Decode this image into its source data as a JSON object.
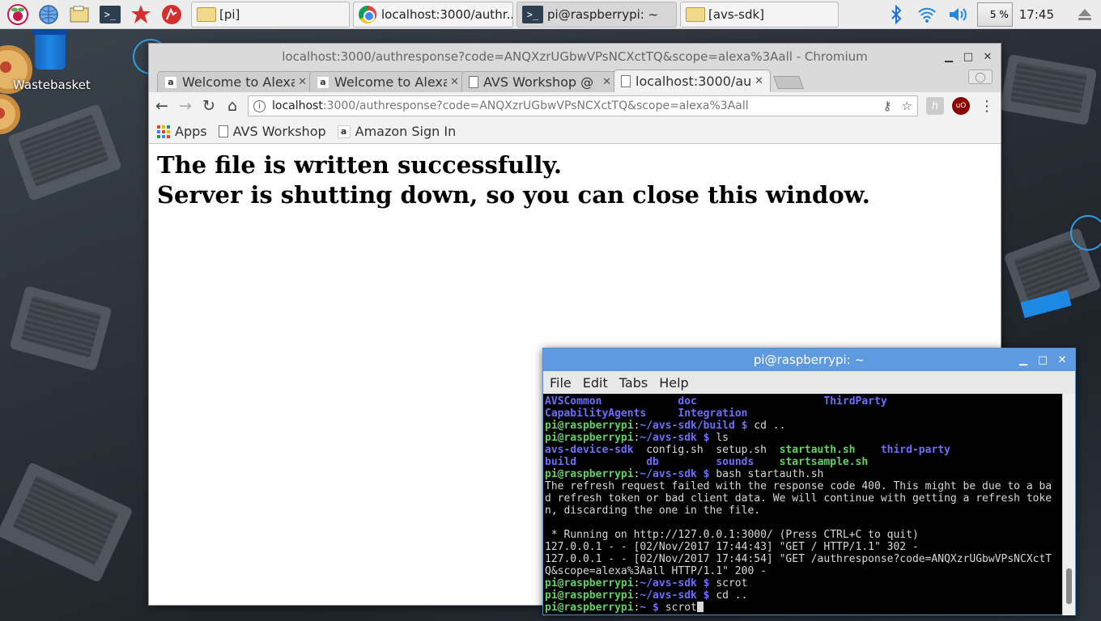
{
  "taskbar": {
    "buttons": [
      {
        "label": "[pi]",
        "icon": "folder-icon"
      },
      {
        "label": "localhost:3000/authr...",
        "icon": "chromium-icon"
      },
      {
        "label": "pi@raspberrypi: ~",
        "icon": "terminal-icon"
      },
      {
        "label": "[avs-sdk]",
        "icon": "folder-icon"
      }
    ],
    "cpu": "5 %",
    "clock": "17:45"
  },
  "desktop": {
    "wastebasket_label": "Wastebasket"
  },
  "chromium": {
    "window_title": "localhost:3000/authresponse?code=ANQXzrUGbwVPsNCXctTQ&scope=alexa%3Aall - Chromium",
    "tabs": [
      {
        "label": "Welcome to Alexa",
        "icon": "amazon-icon"
      },
      {
        "label": "Welcome to Alexa",
        "icon": "amazon-icon"
      },
      {
        "label": "AVS Workshop @",
        "icon": "document-icon"
      },
      {
        "label": "localhost:3000/au",
        "icon": "document-icon"
      }
    ],
    "url_host": "localhost",
    "url_rest": ":3000/authresponse?code=ANQXzrUGbwVPsNCXctTQ&scope=alexa%3Aall",
    "bookmarks": [
      "Apps",
      "AVS Workshop",
      "Amazon Sign In"
    ],
    "content": {
      "line1": "The file is written successfully.",
      "line2": "Server is shutting down, so you can close this window."
    }
  },
  "terminal": {
    "title": "pi@raspberrypi: ~",
    "menu": [
      "File",
      "Edit",
      "Tabs",
      "Help"
    ],
    "lines": [
      {
        "segments": [
          {
            "t": "AVSCommon",
            "c": "dir"
          },
          {
            "t": "            "
          },
          {
            "t": "doc",
            "c": "dir"
          },
          {
            "t": "                    "
          },
          {
            "t": "ThirdParty",
            "c": "dir"
          }
        ]
      },
      {
        "segments": [
          {
            "t": "CapabilityAgents",
            "c": "dir"
          },
          {
            "t": "     "
          },
          {
            "t": "Integration",
            "c": "dir"
          }
        ]
      },
      {
        "segments": [
          {
            "t": "pi@raspberrypi",
            "c": "p"
          },
          {
            "t": ":"
          },
          {
            "t": "~/avs-sdk/build $",
            "c": "path"
          },
          {
            "t": " cd .."
          }
        ]
      },
      {
        "segments": [
          {
            "t": "pi@raspberrypi",
            "c": "p"
          },
          {
            "t": ":"
          },
          {
            "t": "~/avs-sdk $",
            "c": "path"
          },
          {
            "t": " ls"
          }
        ]
      },
      {
        "segments": [
          {
            "t": "avs-device-sdk",
            "c": "dir"
          },
          {
            "t": "  config.sh  setup.sh  "
          },
          {
            "t": "startauth.sh",
            "c": "exe"
          },
          {
            "t": "    "
          },
          {
            "t": "third-party",
            "c": "dir"
          }
        ]
      },
      {
        "segments": [
          {
            "t": "build",
            "c": "dir"
          },
          {
            "t": "           "
          },
          {
            "t": "db",
            "c": "dir"
          },
          {
            "t": "         "
          },
          {
            "t": "sounds",
            "c": "dir"
          },
          {
            "t": "    "
          },
          {
            "t": "startsample.sh",
            "c": "exe"
          }
        ]
      },
      {
        "segments": [
          {
            "t": "pi@raspberrypi",
            "c": "p"
          },
          {
            "t": ":"
          },
          {
            "t": "~/avs-sdk $",
            "c": "path"
          },
          {
            "t": " bash startauth.sh"
          }
        ]
      },
      {
        "segments": [
          {
            "t": "The refresh request failed with the response code 400. This might be due to a ba"
          }
        ]
      },
      {
        "segments": [
          {
            "t": "d refresh token or bad client data. We will continue with getting a refresh toke"
          }
        ]
      },
      {
        "segments": [
          {
            "t": "n, discarding the one in the file."
          }
        ]
      },
      {
        "segments": [
          {
            "t": " "
          }
        ]
      },
      {
        "segments": [
          {
            "t": " * Running on http://127.0.0.1:3000/ (Press CTRL+C to quit)"
          }
        ]
      },
      {
        "segments": [
          {
            "t": "127.0.0.1 - - [02/Nov/2017 17:44:43] \"GET / HTTP/1.1\" 302 -"
          }
        ]
      },
      {
        "segments": [
          {
            "t": "127.0.0.1 - - [02/Nov/2017 17:44:54] \"GET /authresponse?code=ANQXzrUGbwVPsNCXctT"
          }
        ]
      },
      {
        "segments": [
          {
            "t": "Q&scope=alexa%3Aall HTTP/1.1\" 200 -"
          }
        ]
      },
      {
        "segments": [
          {
            "t": "pi@raspberrypi",
            "c": "p"
          },
          {
            "t": ":"
          },
          {
            "t": "~/avs-sdk $",
            "c": "path"
          },
          {
            "t": " scrot"
          }
        ]
      },
      {
        "segments": [
          {
            "t": "pi@raspberrypi",
            "c": "p"
          },
          {
            "t": ":"
          },
          {
            "t": "~/avs-sdk $",
            "c": "path"
          },
          {
            "t": " cd .."
          }
        ]
      },
      {
        "segments": [
          {
            "t": "pi@raspberrypi",
            "c": "p"
          },
          {
            "t": ":"
          },
          {
            "t": "~ $",
            "c": "path"
          },
          {
            "t": " scrot"
          }
        ],
        "cursor": true
      }
    ]
  }
}
